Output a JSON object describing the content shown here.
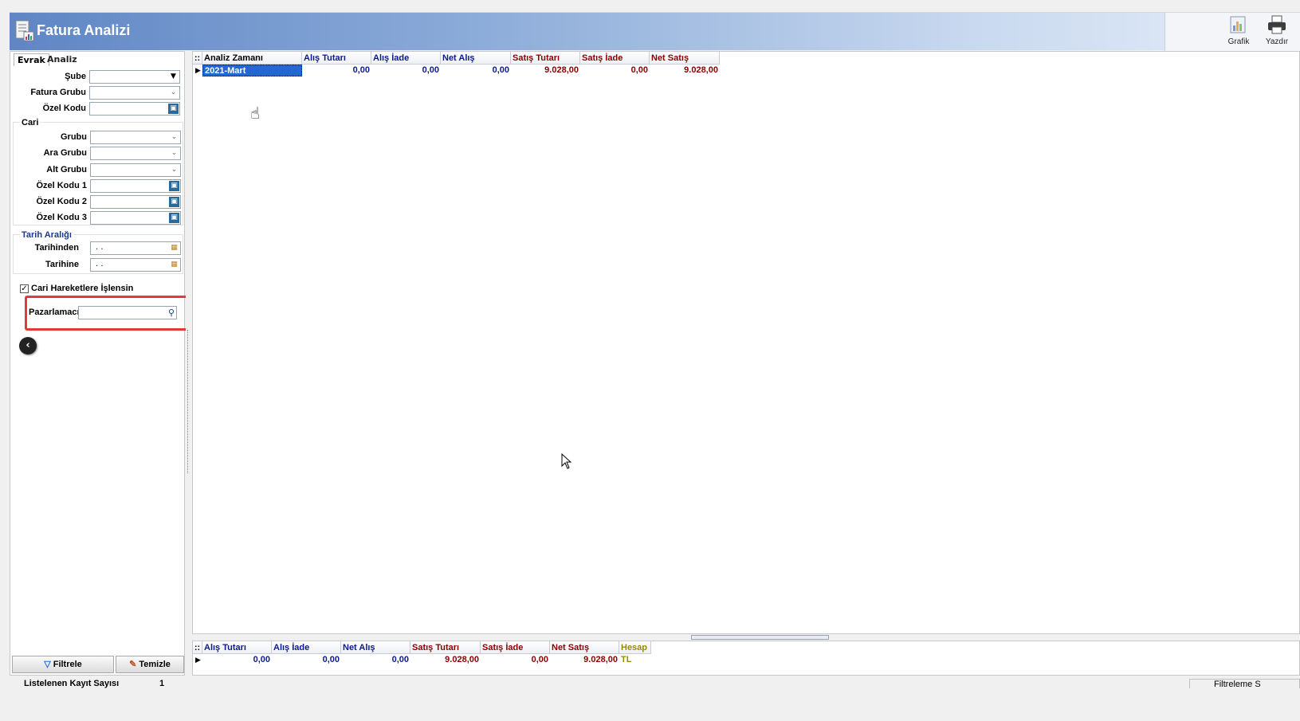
{
  "header": {
    "title": "Fatura Analizi"
  },
  "toolbar": {
    "grafik": "Grafik",
    "yazdir": "Yazdır"
  },
  "tabs": [
    "Evrak",
    "Analiz"
  ],
  "filters": {
    "sube": "Şube",
    "fatura_grubu": "Fatura Grubu",
    "ozel_kodu": "Özel Kodu",
    "cari_title": "Cari",
    "grubu": "Grubu",
    "ara_grubu": "Ara Grubu",
    "alt_grubu": "Alt Grubu",
    "ozel_kodu1": "Özel Kodu 1",
    "ozel_kodu2": "Özel Kodu 2",
    "ozel_kodu3": "Özel Kodu 3",
    "tarih_title": "Tarih Aralığı",
    "tarihinden": "Tarihinden",
    "tarihine": "Tarihine",
    "date_value": ". .",
    "cari_hareket": "Cari Hareketlere İşlensin",
    "pazarlamaci": "Pazarlamacı"
  },
  "buttons": {
    "filtrele": "Filtrele",
    "temizle": "Temizle"
  },
  "grid": {
    "columns": [
      "Analiz Zamanı",
      "Alış Tutarı",
      "Alış İade",
      "Net Alış",
      "Satış Tutarı",
      "Satış İade",
      "Net Satış"
    ],
    "row": [
      "2021-Mart",
      "0,00",
      "0,00",
      "0,00",
      "9.028,00",
      "0,00",
      "9.028,00"
    ]
  },
  "summary": {
    "columns": [
      "Alış Tutarı",
      "Alış İade",
      "Net Alış",
      "Satış Tutarı",
      "Satış İade",
      "Net Satış",
      "Hesap"
    ],
    "row": [
      "0,00",
      "0,00",
      "0,00",
      "9.028,00",
      "0,00",
      "9.028,00",
      "TL"
    ]
  },
  "status": {
    "label": "Listelenen Kayıt Sayısı",
    "count": "1",
    "right": "Filtreleme S"
  }
}
